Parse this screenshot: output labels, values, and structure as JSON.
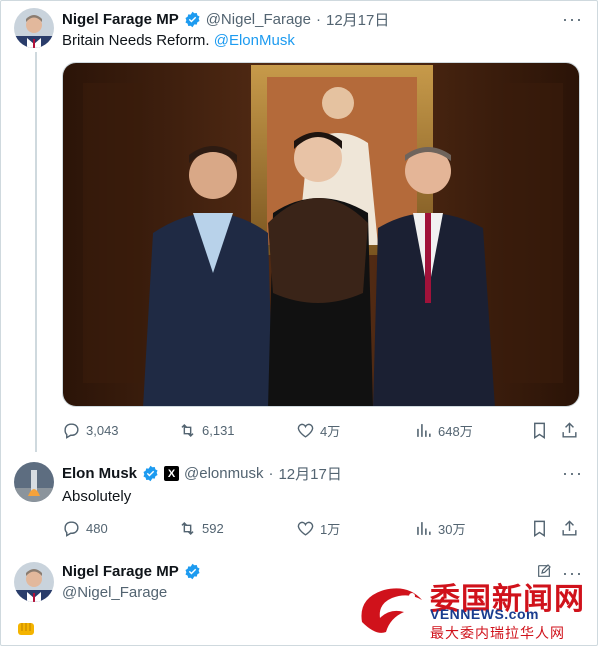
{
  "tweets": [
    {
      "name": "Nigel Farage MP",
      "handle": "@Nigel_Farage",
      "separator": "·",
      "time": "12月17日",
      "text": "Britain Needs Reform. ",
      "mention": "@ElonMusk",
      "stats": {
        "replies": "3,043",
        "retweets": "6,131",
        "likes": "4万",
        "views": "648万"
      }
    },
    {
      "name": "Elon Musk",
      "handle": "@elonmusk",
      "separator": "·",
      "time": "12月17日",
      "text": "Absolutely",
      "stats": {
        "replies": "480",
        "retweets": "592",
        "likes": "1万",
        "views": "30万"
      }
    }
  ],
  "reply": {
    "name": "Nigel Farage MP",
    "handle": "@Nigel_Farage"
  },
  "more_label": "···",
  "xlogo_label": "X",
  "watermark": {
    "title": "委国新闻网",
    "url": "VENNEWS.com",
    "subtitle": "最大委内瑞拉华人网"
  },
  "colors": {
    "accent": "#1d9bf0",
    "muted": "#536471",
    "watermark_red": "#d0121b",
    "watermark_blue": "#1a3d8f"
  }
}
